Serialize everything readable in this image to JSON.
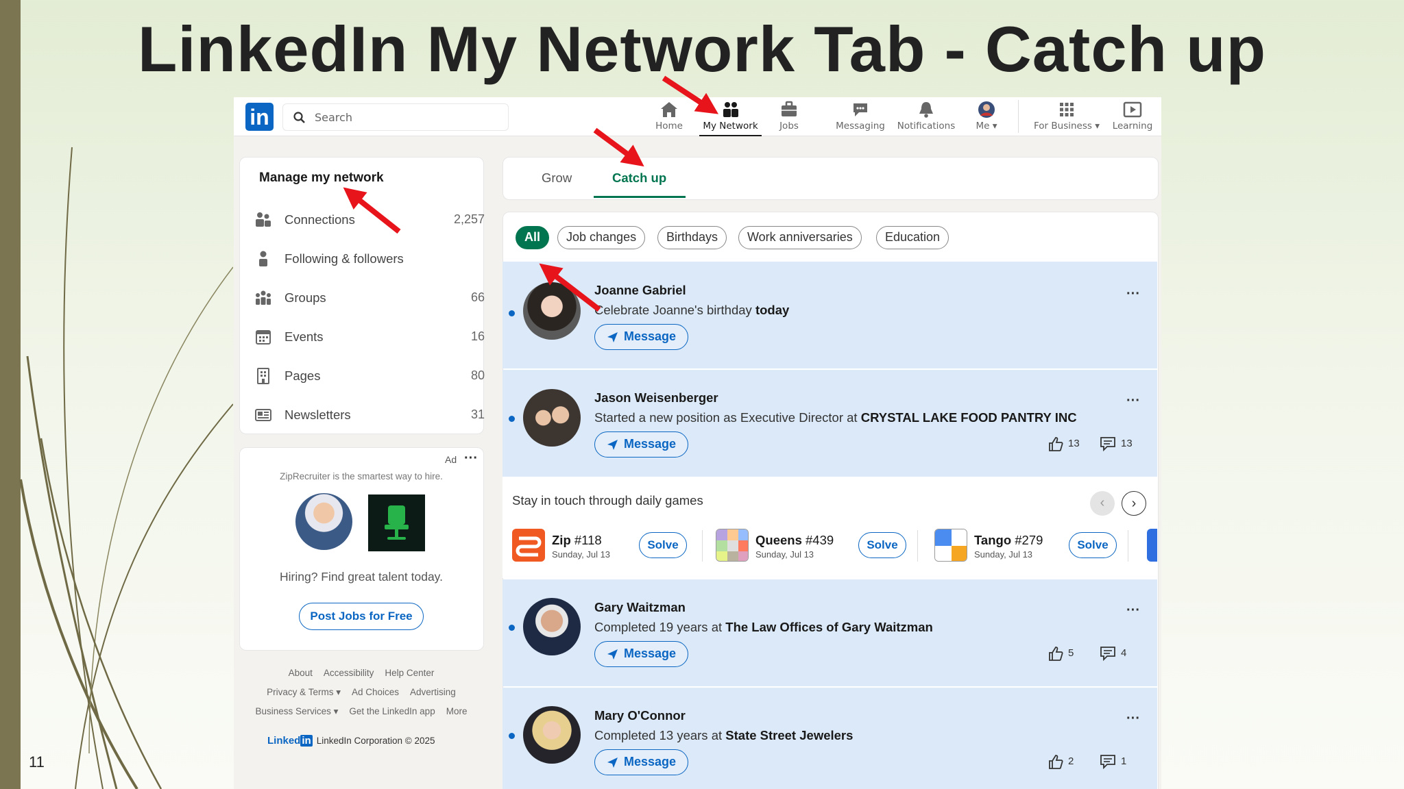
{
  "slide": {
    "title": "LinkedIn My Network Tab - Catch up",
    "number": "11"
  },
  "topnav": {
    "search_placeholder": "Search",
    "items": [
      {
        "label": "Home",
        "icon": "home-icon"
      },
      {
        "label": "My Network",
        "icon": "network-icon",
        "active": true
      },
      {
        "label": "Jobs",
        "icon": "briefcase-icon"
      },
      {
        "label": "Messaging",
        "icon": "chat-icon"
      },
      {
        "label": "Notifications",
        "icon": "bell-icon"
      },
      {
        "label": "Me",
        "icon": "avatar"
      },
      {
        "label": "For Business",
        "icon": "grid-icon"
      },
      {
        "label": "Learning",
        "icon": "play-icon"
      }
    ]
  },
  "manage": {
    "title": "Manage my network",
    "items": [
      {
        "label": "Connections",
        "count": "2,257"
      },
      {
        "label": "Following & followers",
        "count": ""
      },
      {
        "label": "Groups",
        "count": "66"
      },
      {
        "label": "Events",
        "count": "16"
      },
      {
        "label": "Pages",
        "count": "80"
      },
      {
        "label": "Newsletters",
        "count": "31"
      }
    ]
  },
  "ad": {
    "tag": "Ad",
    "text": "ZipRecruiter is the smartest way to hire.",
    "hiring": "Hiring? Find great talent today.",
    "button": "Post Jobs for Free"
  },
  "footer": {
    "row1": [
      "About",
      "Accessibility",
      "Help Center"
    ],
    "row2": [
      "Privacy & Terms ▾",
      "Ad Choices",
      "Advertising"
    ],
    "row3": [
      "Business Services ▾",
      "Get the LinkedIn app",
      "More"
    ],
    "logo_text": "Linked",
    "logo_box": "in",
    "corp": "LinkedIn Corporation © 2025"
  },
  "tabs": {
    "grow": "Grow",
    "catch_up": "Catch up"
  },
  "filters": [
    "All",
    "Job changes",
    "Birthdays",
    "Work anniversaries",
    "Education"
  ],
  "feed": [
    {
      "name": "Joanne Gabriel",
      "desc": "Celebrate Joanne's birthday ",
      "desc_bold": "today",
      "button": "Message",
      "likes": "",
      "comments": ""
    },
    {
      "name": "Jason Weisenberger",
      "desc": "Started a new position as Executive Director at ",
      "desc_bold": "CRYSTAL LAKE FOOD PANTRY INC",
      "button": "Message",
      "likes": "13",
      "comments": "13"
    },
    {
      "name": "Gary Waitzman",
      "desc": "Completed 19 years at ",
      "desc_bold": "The Law Offices of Gary Waitzman",
      "button": "Message",
      "likes": "5",
      "comments": "4"
    },
    {
      "name": "Mary O'Connor",
      "desc": "Completed 13 years at ",
      "desc_bold": "State Street Jewelers",
      "button": "Message",
      "likes": "2",
      "comments": "1"
    }
  ],
  "games": {
    "title": "Stay in touch through daily games",
    "prev": "‹",
    "next": "›",
    "items": [
      {
        "name": "Zip",
        "number": "#118",
        "date": "Sunday, Jul 13",
        "button": "Solve"
      },
      {
        "name": "Queens",
        "number": "#439",
        "date": "Sunday, Jul 13",
        "button": "Solve"
      },
      {
        "name": "Tango",
        "number": "#279",
        "date": "Sunday, Jul 13",
        "button": "Solve"
      }
    ]
  },
  "colors": {
    "brand": "#0a66c2",
    "accent_green": "#01754f",
    "highlight_bg": "#dbe9f8",
    "annotation_arrow": "#e8141b"
  }
}
